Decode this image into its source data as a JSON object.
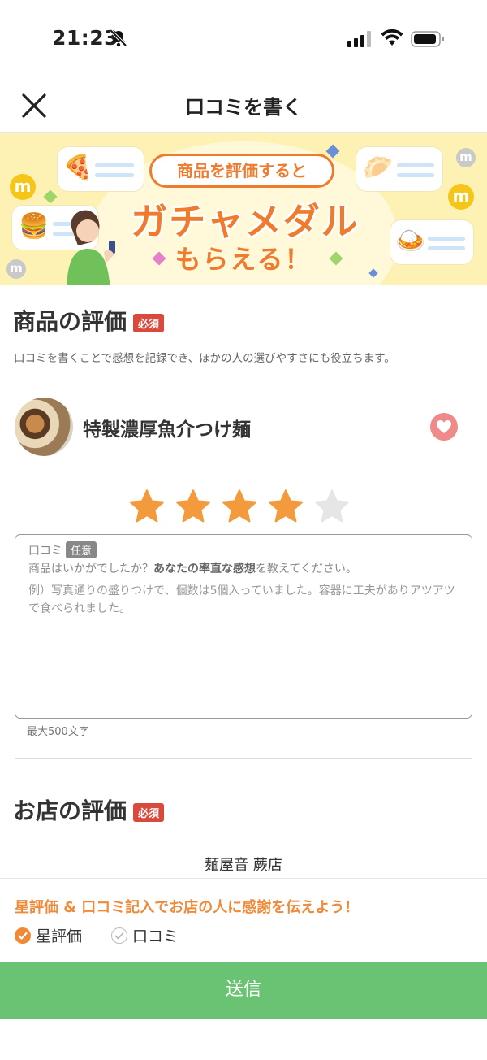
{
  "status": {
    "time": "21:23"
  },
  "header": {
    "title": "口コミを書く"
  },
  "banner": {
    "pill_text": "商品を評価すると",
    "headline": "ガチャメダル",
    "sub": "もらえる！",
    "coin_letter": "m"
  },
  "product_section": {
    "title": "商品の評価",
    "required_badge": "必須",
    "description": "口コミを書くことで感想を記録でき、ほかの人の選びやすさにも役立ちます。",
    "product_name": "特製濃厚魚介つけ麺",
    "rating": 4,
    "max_rating": 5
  },
  "review": {
    "label": "口コミ",
    "optional_badge": "任意",
    "placeholder_prefix": "商品はいかがでしたか？",
    "placeholder_bold": "あなたの率直な感想",
    "placeholder_suffix": "を教えてください。",
    "example": "例）写真通りの盛りつけで、個数は5個入っていました。容器に工夫がありアツアツで食べられました。",
    "max_length": "最大500文字"
  },
  "shop_section": {
    "title": "お店の評価",
    "required_badge": "必須",
    "shop_name": "麺屋音 蕨店"
  },
  "bottom": {
    "thanks_text": "星評価 & 口コミ記入でお店の人に感謝を伝えよう！",
    "checks": [
      {
        "label": "星評価",
        "done": true
      },
      {
        "label": "口コミ",
        "done": false
      }
    ],
    "submit_label": "送信"
  },
  "colors": {
    "accent": "#ef7b2e",
    "required": "#d94a3c",
    "submit": "#69c372",
    "star_on": "#f39a3c",
    "star_off": "#e6e6e6"
  }
}
